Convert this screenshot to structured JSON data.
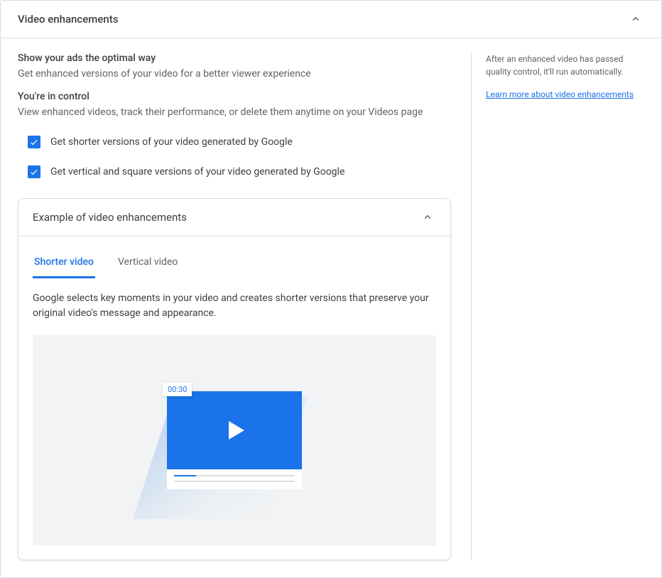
{
  "header": {
    "title": "Video enhancements"
  },
  "intro": {
    "heading1": "Show your ads the optimal way",
    "desc1": "Get enhanced versions of your video for a better viewer experience",
    "heading2": "You're in control",
    "desc2": "View enhanced videos, track their performance, or delete them anytime on your Videos page"
  },
  "checkboxes": {
    "shorter": "Get shorter versions of your video generated by Google",
    "vertical": "Get vertical and square versions of your video generated by Google"
  },
  "example": {
    "title": "Example of video enhancements",
    "tabs": {
      "shorter": "Shorter video",
      "vertical": "Vertical video"
    },
    "desc": "Google selects key moments in your video and creates shorter versions that preserve your original video's message and appearance.",
    "timestamp": "00:30"
  },
  "side": {
    "text": "After an enhanced video has passed quality control, it'll run automatically.",
    "link": "Learn more about video enhancements"
  }
}
